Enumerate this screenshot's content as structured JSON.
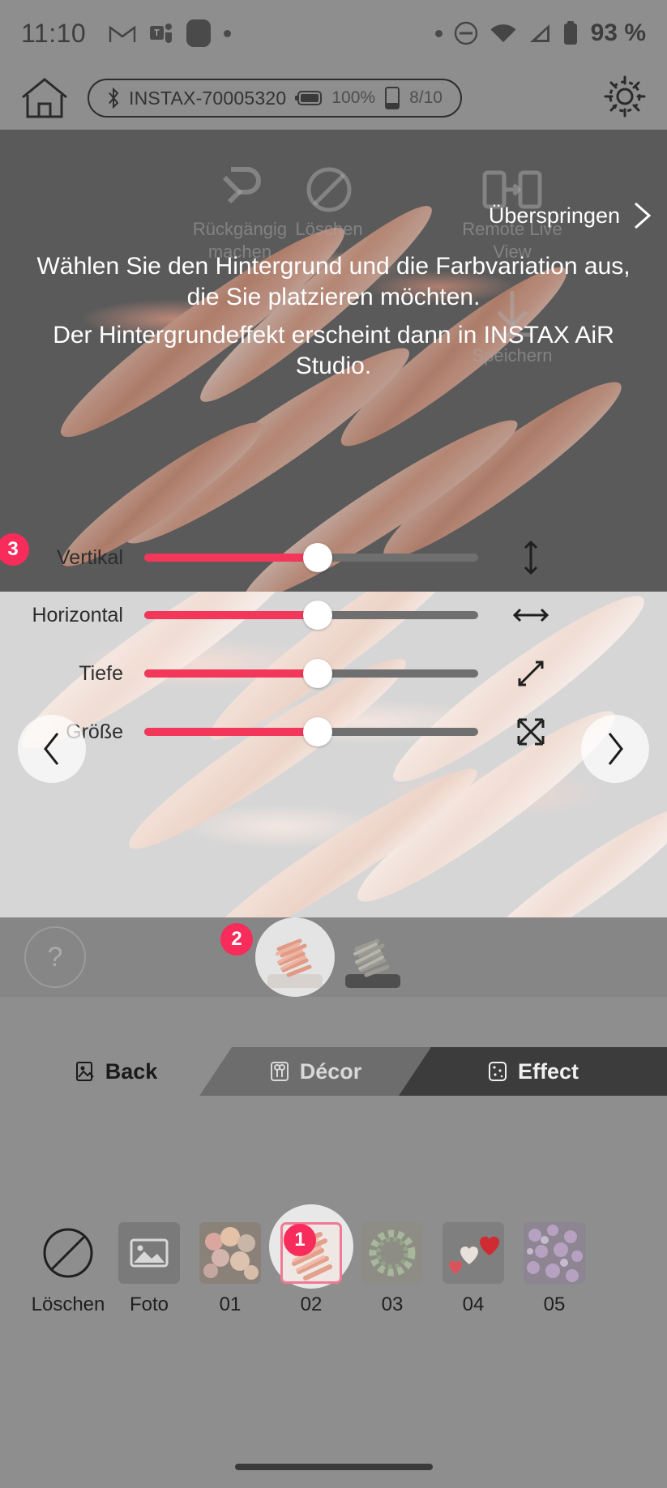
{
  "status_bar": {
    "time": "11:10",
    "battery_percent": "93 %",
    "icons": [
      "gmail-icon",
      "teams-icon",
      "app-icon",
      "dot-icon",
      "dot-icon",
      "dnd-icon",
      "wifi-icon",
      "signal-icon",
      "battery-icon"
    ]
  },
  "app_header": {
    "home_icon": "home-icon",
    "device_name": "INSTAX-70005320",
    "battery_icon": "battery-icon",
    "battery_percent": "100%",
    "film_icon": "film-pack-icon",
    "film_count": "8/10",
    "settings_icon": "gear-icon"
  },
  "tutorial": {
    "skip_label": "Überspringen",
    "skip_chevron": "chevron-right-icon",
    "line1": "Wählen Sie den Hintergrund und die Farbvariation aus, die Sie platzieren möchten.",
    "line2": "Der Hintergrundeffekt erscheint dann in INSTAX AiR Studio.",
    "badge_1": "1",
    "badge_2": "2",
    "badge_3": "3"
  },
  "canvas_tools": [
    {
      "name": "undo-tool",
      "icon": "undo-icon",
      "label": "Rückgängig machen"
    },
    {
      "name": "clear-tool",
      "icon": "clear-icon",
      "label": "Löschen"
    },
    {
      "name": "remote-tool",
      "icon": "remote-view-icon",
      "label": "Remote Live View"
    },
    {
      "name": "save-tool",
      "icon": "download-icon",
      "label": "Speichern"
    }
  ],
  "sliders": [
    {
      "label": "Vertikal",
      "value": 52,
      "icon": "arrows-vertical-icon"
    },
    {
      "label": "Horizontal",
      "value": 52,
      "icon": "arrows-horizontal-icon"
    },
    {
      "label": "Tiefe",
      "value": 52,
      "icon": "arrows-diagonal-icon"
    },
    {
      "label": "Größe",
      "value": 52,
      "icon": "resize-icon"
    }
  ],
  "nav": {
    "prev_icon": "chevron-left-icon",
    "next_icon": "chevron-right-icon"
  },
  "variation_strip": {
    "help_icon": "question-mark-icon",
    "items": [
      {
        "name": "variation-pink",
        "selected": true
      },
      {
        "name": "variation-gray",
        "selected": false
      }
    ]
  },
  "tabs": [
    {
      "label": "Back",
      "icon": "back-layer-icon",
      "active": false
    },
    {
      "label": "Décor",
      "icon": "decor-icon",
      "active": false
    },
    {
      "label": "Effect",
      "icon": "effect-icon",
      "active": true
    }
  ],
  "filmstrip": [
    {
      "label": "Löschen",
      "icon": "no-entry-icon",
      "selected": false,
      "kind": "icon"
    },
    {
      "label": "Foto",
      "icon": "photo-icon",
      "selected": false,
      "kind": "icon"
    },
    {
      "label": "01",
      "icon": "balloons-thumb",
      "selected": false,
      "kind": "thumb"
    },
    {
      "label": "02",
      "icon": "brush-thumb",
      "selected": true,
      "kind": "thumb"
    },
    {
      "label": "03",
      "icon": "wreath-thumb",
      "selected": false,
      "kind": "thumb"
    },
    {
      "label": "04",
      "icon": "hearts-thumb",
      "selected": false,
      "kind": "thumb"
    },
    {
      "label": "05",
      "icon": "flowers-thumb",
      "selected": false,
      "kind": "thumb"
    }
  ],
  "colors": {
    "accent_pink": "#f2375a",
    "badge_pink": "#f72c5b",
    "panel_gray": "#d6d6d6",
    "canvas_gray": "#6e6e6e",
    "app_gray": "#8e8e8e",
    "tab_active": "#3c3c3c"
  }
}
